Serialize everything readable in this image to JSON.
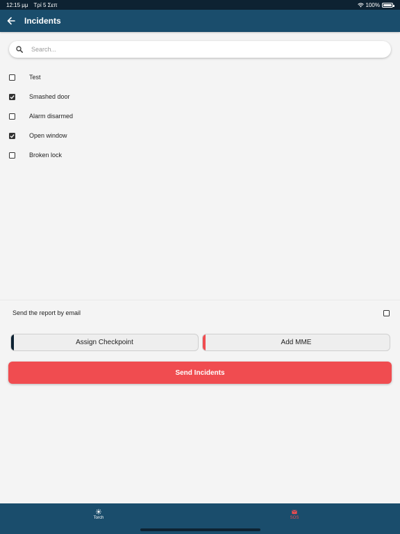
{
  "status_bar": {
    "time": "12:15 μμ",
    "date": "Τρί 5 Σεπ",
    "battery": "100%"
  },
  "app_bar": {
    "title": "Incidents",
    "back_icon": "arrow-left-icon"
  },
  "search": {
    "placeholder": "Search...",
    "value": ""
  },
  "incidents": [
    {
      "label": "Test",
      "checked": false
    },
    {
      "label": "Smashed door",
      "checked": true
    },
    {
      "label": "Alarm disarmed",
      "checked": false
    },
    {
      "label": "Open window",
      "checked": true
    },
    {
      "label": "Broken lock",
      "checked": false
    }
  ],
  "email_option": {
    "label": "Send the report by email",
    "checked": false
  },
  "buttons": {
    "assign_checkpoint": "Assign Checkpoint",
    "add_mme": "Add MME",
    "send_incidents": "Send Incidents"
  },
  "bottom_tabs": [
    {
      "label": "Torch",
      "icon": "flashlight-icon"
    },
    {
      "label": "SOS",
      "icon": "sos-icon"
    }
  ],
  "colors": {
    "primary": "#1a4d6c",
    "status_bar": "#0d2232",
    "accent_red": "#f04c50",
    "background": "#f4f4f4"
  }
}
